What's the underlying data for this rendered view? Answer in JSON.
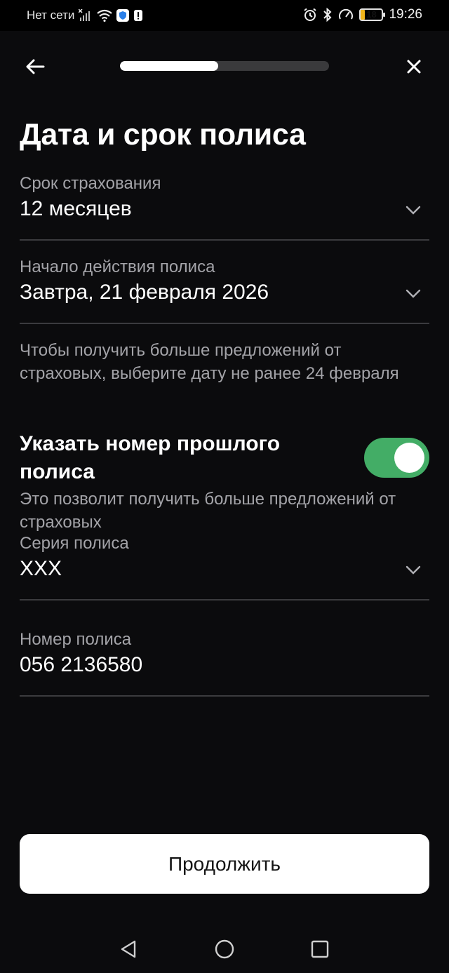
{
  "status_bar": {
    "carrier": "Нет сети",
    "battery_level": "18",
    "battery_fraction": 0.18,
    "time": "19:26"
  },
  "header": {
    "back_icon": "arrow-left-icon",
    "close_icon": "close-icon",
    "progress_fraction": 0.47
  },
  "page": {
    "title": "Дата и срок полиса"
  },
  "fields": {
    "term": {
      "label": "Срок страхования",
      "value": "12 месяцев"
    },
    "start": {
      "label": "Начало действия полиса",
      "value": "Завтра, 21 февраля 2026"
    },
    "series": {
      "label": "Серия полиса",
      "value": "ХХХ"
    },
    "number": {
      "label": "Номер полиса",
      "value": "056 2136580"
    }
  },
  "hint_date": "Чтобы получить больше предложений от страховых, выберите дату не ранее 24 февраля",
  "previous_policy": {
    "title": "Указать номер прошлого полиса",
    "enabled": true,
    "hint": "Это позволит получить больше предложений от страховых"
  },
  "continue_label": "Продолжить",
  "colors": {
    "background": "#0b0b0d",
    "accent_green": "#43ad66",
    "secondary_text": "#a3a3a8",
    "battery_yellow": "#f2b61a"
  }
}
